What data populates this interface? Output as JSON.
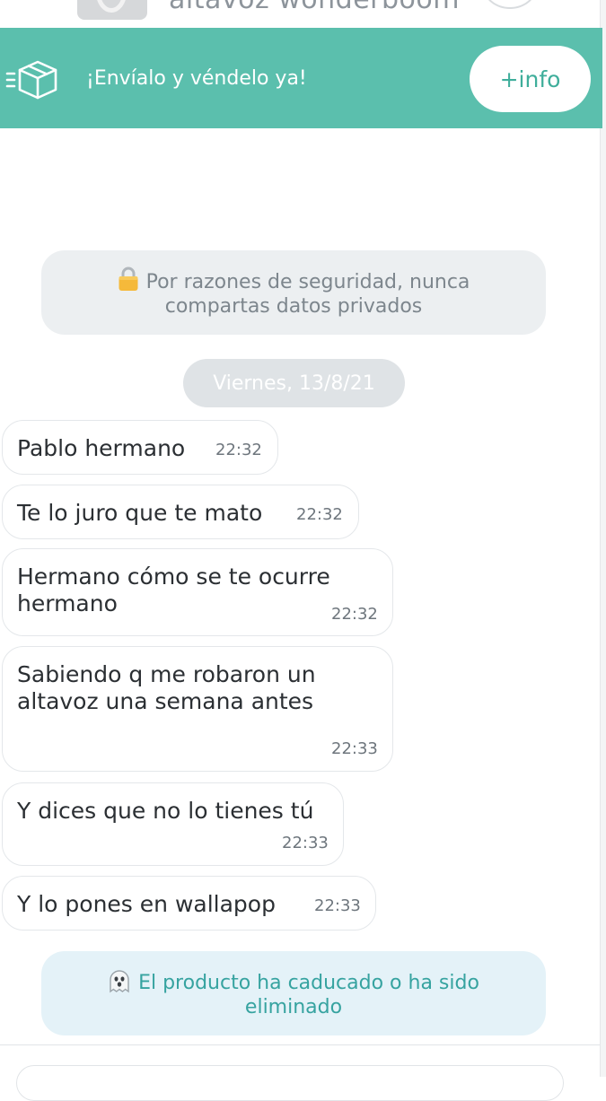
{
  "product": {
    "title": "altavoz wonderboom"
  },
  "banner": {
    "text": "¡Envíalo y véndelo ya!",
    "info_button": "+info",
    "color": "#5bbfad"
  },
  "security_notice": {
    "icon": "lock-icon",
    "line1": "Por razones de seguridad, nunca",
    "line2": "compartas datos privados"
  },
  "date_separator": "Viernes, 13/8/21",
  "messages": [
    {
      "lines": [
        "Pablo hermano"
      ],
      "time": "22:32"
    },
    {
      "lines": [
        "Te lo juro que te mato"
      ],
      "time": "22:32"
    },
    {
      "lines": [
        "Hermano cómo se te ocurre",
        "hermano"
      ],
      "time": "22:32"
    },
    {
      "lines": [
        "Sabiendo q me robaron un",
        "altavoz una semana antes"
      ],
      "time": "22:33"
    },
    {
      "lines": [
        "Y dices que no lo tienes tú"
      ],
      "time": "22:33"
    },
    {
      "lines": [
        "Y lo pones en wallapop"
      ],
      "time": "22:33"
    }
  ],
  "expired_notice": {
    "icon": "ghost-icon",
    "line1": "El producto ha caducado o ha sido",
    "line2": "eliminado"
  },
  "input": {
    "placeholder": ""
  }
}
